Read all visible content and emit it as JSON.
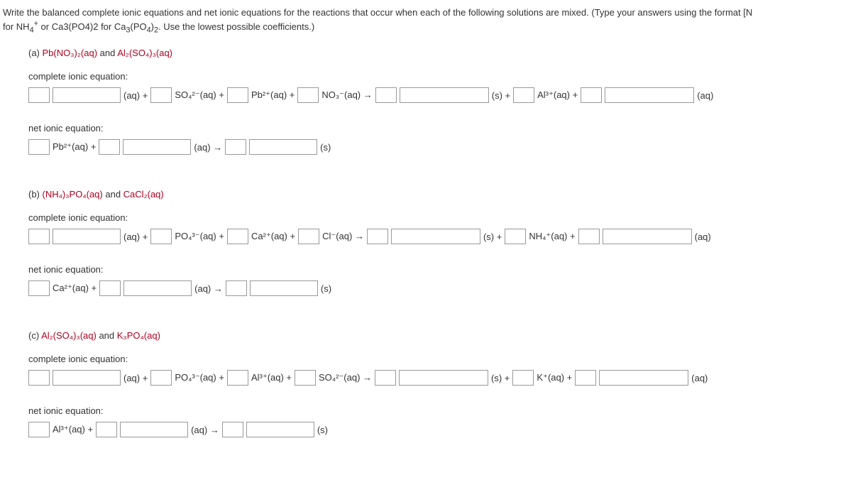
{
  "instructions_line1": "Write the balanced complete ionic equations and net ionic equations for the reactions that occur when each of the following solutions are mixed. (Type your answers using the format [N",
  "instructions_line2_prefix": "for NH",
  "instructions_line2_sub1": "4",
  "instructions_line2_sup1": "+",
  "instructions_line2_mid": " or Ca3(PO4)2 for Ca",
  "instructions_line2_sub2": "3",
  "instructions_line2_mid2": "(PO",
  "instructions_line2_sub3": "4",
  "instructions_line2_mid3": ")",
  "instructions_line2_sub4": "2",
  "instructions_line2_end": ". Use the lowest possible coefficients.)",
  "partA": {
    "label_prefix": "(a) ",
    "react1": "Pb(NO₃)₂(aq)",
    "joiner": " and ",
    "react2": "Al₂(SO₄)₃(aq)",
    "cie_label": "complete ionic equation:",
    "nie_label": "net ionic equation:",
    "tokens": {
      "aq_plus": "(aq) +",
      "so4": "SO₄²⁻(aq) +",
      "pb2": "Pb²⁺(aq) +",
      "no3": "NO₃⁻(aq) →",
      "s_plus": "(s) +",
      "al3": "Al³⁺(aq) +",
      "aq_end": "(aq)",
      "net_first": "Pb²⁺(aq) +",
      "net_aq_arrow": "(aq) →",
      "net_s": "(s)"
    }
  },
  "partB": {
    "label_prefix": "(b) ",
    "react1": "(NH₄)₃PO₄(aq)",
    "joiner": " and ",
    "react2": "CaCl₂(aq)",
    "cie_label": "complete ionic equation:",
    "nie_label": "net ionic equation:",
    "tokens": {
      "aq_plus": "(aq) +",
      "po4": "PO₄³⁻(aq) +",
      "ca2": "Ca²⁺(aq) +",
      "cl": "Cl⁻(aq) →",
      "s_plus": "(s) +",
      "nh4": "NH₄⁺(aq) +",
      "aq_end": "(aq)",
      "net_first": "Ca²⁺(aq) +",
      "net_aq_arrow": "(aq) →",
      "net_s": "(s)"
    }
  },
  "partC": {
    "label_prefix": "(c) ",
    "react1": "Al₂(SO₄)₃(aq)",
    "joiner": " and ",
    "react2": "K₃PO₄(aq)",
    "cie_label": "complete ionic equation:",
    "nie_label": "net ionic equation:",
    "tokens": {
      "aq_plus": "(aq) +",
      "po4": "PO₄³⁻(aq) +",
      "al3": "Al³⁺(aq) +",
      "so4": "SO₄²⁻(aq) →",
      "s_plus": "(s) +",
      "k": "K⁺(aq) +",
      "aq_end": "(aq)",
      "net_first": "Al³⁺(aq) +",
      "net_aq_arrow": "(aq) →",
      "net_s": "(s)"
    }
  }
}
